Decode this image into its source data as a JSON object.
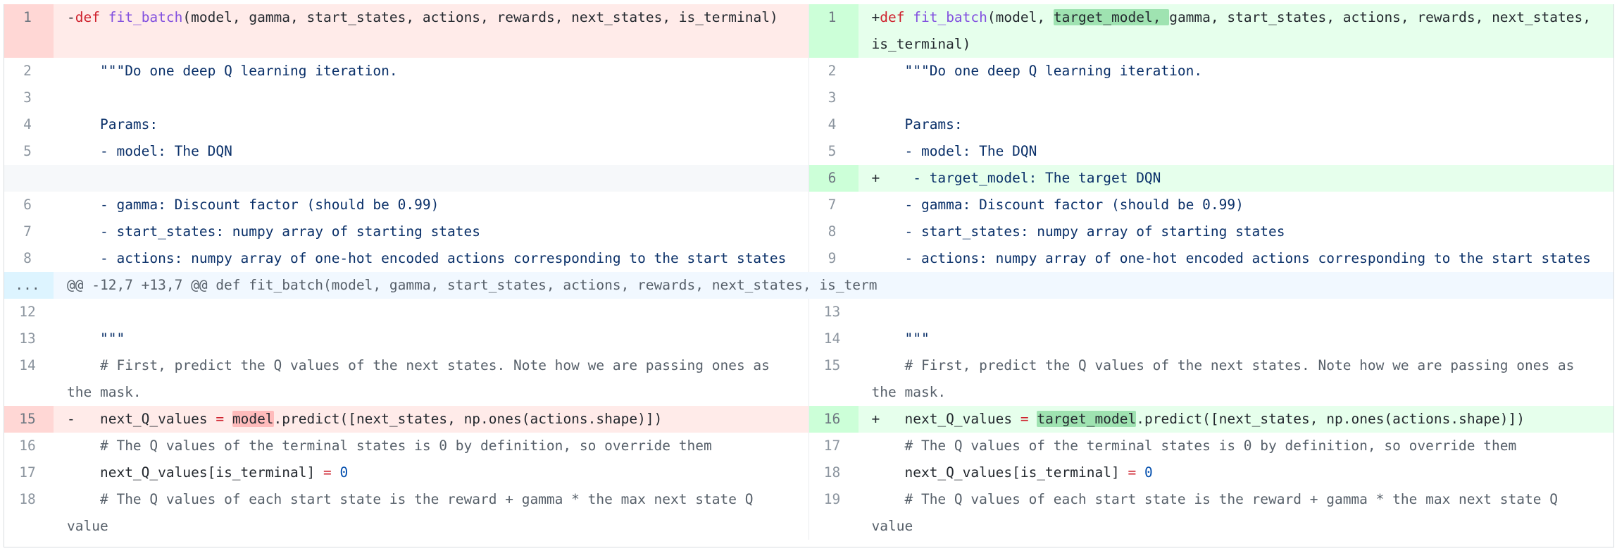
{
  "hunk_header": "@@ -12,7 +13,7 @@ def fit_batch(model, gamma, start_states, actions, rewards, next_states, is_term",
  "hunk_marker": "...",
  "rows": {
    "r1": {
      "left_num": "1",
      "left_sign": "-",
      "left_kw": "def",
      "left_fn": "fit_batch",
      "left_rest": "(model, gamma, start_states, actions, rewards, next_states, is_terminal)",
      "right_num": "1",
      "right_sign": "+",
      "right_kw": "def",
      "right_fn": "fit_batch",
      "right_pre": "(model, ",
      "right_hl": "target_model, ",
      "right_rest": "gamma, start_states, actions, rewards, next_states, is_terminal)"
    },
    "r2": {
      "left_num": "2",
      "right_num": "2",
      "text": "    \"\"\"Do one deep Q learning iteration."
    },
    "r3": {
      "left_num": "3",
      "right_num": "3",
      "text": ""
    },
    "r4": {
      "left_num": "4",
      "right_num": "4",
      "text": "    Params:"
    },
    "r5": {
      "left_num": "5",
      "right_num": "5",
      "text": "    - model: The DQN"
    },
    "r6": {
      "right_num": "6",
      "right_sign": "+",
      "right_text": "    - target_model: The target DQN"
    },
    "r7": {
      "left_num": "6",
      "right_num": "7",
      "text": "    - gamma: Discount factor (should be 0.99)"
    },
    "r8": {
      "left_num": "7",
      "right_num": "8",
      "text": "    - start_states: numpy array of starting states"
    },
    "r9": {
      "left_num": "8",
      "right_num": "9",
      "text": "    - actions: numpy array of one-hot encoded actions corresponding to the start states"
    },
    "r10": {
      "left_num": "12",
      "right_num": "13",
      "text": ""
    },
    "r11": {
      "left_num": "13",
      "right_num": "14",
      "text": "    \"\"\""
    },
    "r12": {
      "left_num": "14",
      "right_num": "15",
      "text": "    # First, predict the Q values of the next states. Note how we are passing ones as the mask."
    },
    "r13": {
      "left_num": "15",
      "left_sign": "-",
      "left_pre": "   next_Q_values ",
      "eq": "=",
      "left_hl": "model",
      "left_rest": ".predict([next_states, np.ones(actions.shape)])",
      "right_num": "16",
      "right_sign": "+",
      "right_pre": "   next_Q_values ",
      "right_hl": "target_model",
      "right_rest": ".predict([next_states, np.ones(actions.shape)])"
    },
    "r14": {
      "left_num": "16",
      "right_num": "17",
      "text": "    # The Q values of the terminal states is 0 by definition, so override them"
    },
    "r15": {
      "left_num": "17",
      "right_num": "18",
      "pre": "    next_Q_values[is_terminal] ",
      "eq": "=",
      "zero": "0"
    },
    "r16": {
      "left_num": "18",
      "right_num": "19",
      "text": "    # The Q values of each start state is the reward + gamma * the max next state Q value"
    }
  }
}
